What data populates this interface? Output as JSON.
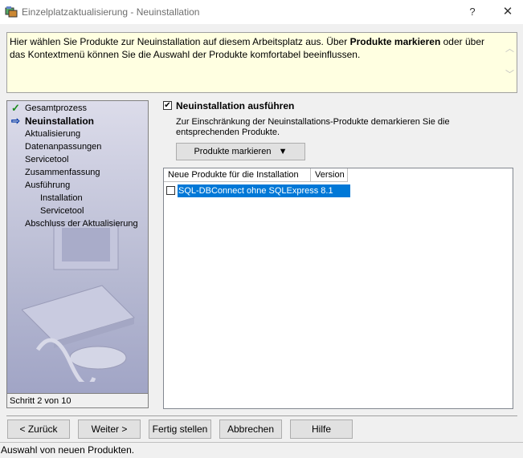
{
  "window": {
    "title": "Einzelplatzaktualisierung - Neuinstallation",
    "help": "?",
    "close": "✕"
  },
  "info": {
    "part1": "Hier wählen Sie Produkte zur Neuinstallation auf diesem Arbeitsplatz aus. Über ",
    "bold": "Produkte markieren",
    "part2": " oder über das Kontextmenü können Sie die Auswahl der Produkte komfortabel beeinflussen."
  },
  "steps": [
    {
      "label": "Gesamtprozess",
      "mark": "✓",
      "state": "done"
    },
    {
      "label": "Neuinstallation",
      "mark": "⇨",
      "state": "current"
    },
    {
      "label": "Aktualisierung"
    },
    {
      "label": "Datenanpassungen"
    },
    {
      "label": "Servicetool"
    },
    {
      "label": "Zusammenfassung"
    },
    {
      "label": "Ausführung"
    },
    {
      "label": "Installation",
      "sub": true
    },
    {
      "label": "Servicetool",
      "sub": true
    },
    {
      "label": "Abschluss der Aktualisierung"
    }
  ],
  "step_counter": "Schritt 2 von 10",
  "main": {
    "checkbox_label": "Neuinstallation ausführen",
    "checkbox_checked": true,
    "hint": "Zur Einschränkung der Neuinstallations-Produkte demarkieren Sie die entsprechenden Produkte.",
    "mark_button": "Produkte markieren",
    "columns": [
      "Neue Produkte für die Installation",
      "Version"
    ],
    "rows": [
      {
        "name": "SQL-DBConnect ohne SQLExpress 8.1",
        "version": "",
        "checked": false,
        "selected": true
      }
    ]
  },
  "buttons": {
    "back": "< Zurück",
    "next": "Weiter >",
    "finish": "Fertig stellen",
    "cancel": "Abbrechen",
    "help": "Hilfe"
  },
  "status": "Auswahl von neuen Produkten.",
  "colors": {
    "info_bg": "#ffffe1",
    "selection": "#0078d7",
    "check": "#1a8a1a",
    "arrow": "#0037a6"
  }
}
